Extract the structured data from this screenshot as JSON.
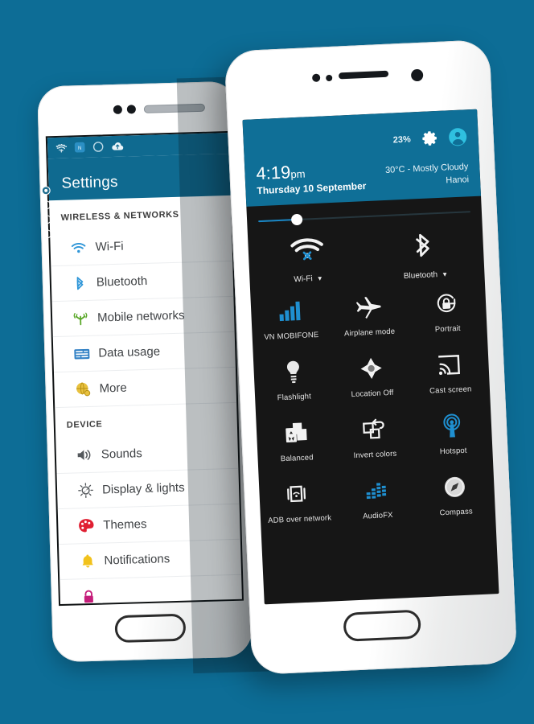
{
  "theme": {
    "page_background": "#0d6d96",
    "header_blue": "#0f6f97",
    "accent_blue": "#1a86c4",
    "panel_dark": "#161616"
  },
  "left_phone": {
    "name": "settings-phone",
    "statusbar": {
      "icons": [
        "wifi-icon",
        "sim-network-icon",
        "do-not-disturb-icon",
        "cloud-upload-icon"
      ]
    },
    "header": {
      "title": "Settings"
    },
    "page_indicator": {
      "count": 4,
      "active": 0
    },
    "sections": [
      {
        "label": "WIRELESS & NETWORKS",
        "items": [
          {
            "label": "Wi-Fi",
            "icon": "wifi-icon",
            "color": "#2f96d8"
          },
          {
            "label": "Bluetooth",
            "icon": "bluetooth-icon",
            "color": "#2f96d8"
          },
          {
            "label": "Mobile networks",
            "icon": "cell-tower-icon",
            "color": "#5aa829"
          },
          {
            "label": "Data usage",
            "icon": "data-usage-icon",
            "color": "#2f7fc4"
          },
          {
            "label": "More",
            "icon": "globe-icon",
            "color": "#e8c13e"
          }
        ]
      },
      {
        "label": "DEVICE",
        "items": [
          {
            "label": "Sounds",
            "icon": "speaker-icon",
            "color": "#55595d"
          },
          {
            "label": "Display & lights",
            "icon": "brightness-icon",
            "color": "#55595d"
          },
          {
            "label": "Themes",
            "icon": "palette-icon",
            "color": "#e01f32"
          },
          {
            "label": "Notifications",
            "icon": "bell-icon",
            "color": "#f2c21b"
          },
          {
            "label": "",
            "icon": "lock-icon",
            "color": "#c51d7a"
          }
        ]
      }
    ]
  },
  "right_phone": {
    "name": "quick-settings-phone",
    "header": {
      "battery": "23%",
      "settings_icon": "gear-icon",
      "user_icon": "user-avatar-icon",
      "time": "4:19",
      "time_suffix": "pm",
      "date": "Thursday 10 September",
      "weather_line1": "30°C - Mostly Cloudy",
      "weather_line2": "Hanoi"
    },
    "brightness": {
      "value_percent": 18,
      "name": "brightness-slider"
    },
    "top_toggles": [
      {
        "label": "Wi-Fi",
        "icon": "wifi-off-icon",
        "has_caret": true
      },
      {
        "label": "Bluetooth",
        "icon": "bluetooth-icon",
        "has_caret": true
      }
    ],
    "tiles": [
      {
        "label": "VN MOBIFONE",
        "icon": "signal-bars-icon",
        "active": true
      },
      {
        "label": "Airplane mode",
        "icon": "airplane-icon",
        "active": false
      },
      {
        "label": "Portrait",
        "icon": "rotation-lock-icon",
        "active": false
      },
      {
        "label": "Flashlight",
        "icon": "flashlight-icon",
        "active": false
      },
      {
        "label": "Location Off",
        "icon": "location-icon",
        "active": false
      },
      {
        "label": "Cast screen",
        "icon": "cast-screen-icon",
        "active": false
      },
      {
        "label": "Balanced",
        "icon": "performance-profile-icon",
        "active": false
      },
      {
        "label": "Invert colors",
        "icon": "invert-colors-icon",
        "active": false
      },
      {
        "label": "Hotspot",
        "icon": "hotspot-icon",
        "active": true
      },
      {
        "label": "ADB over network",
        "icon": "adb-network-icon",
        "active": false
      },
      {
        "label": "AudioFX",
        "icon": "audiofx-icon",
        "active": true
      },
      {
        "label": "Compass",
        "icon": "compass-icon",
        "active": false
      }
    ]
  }
}
